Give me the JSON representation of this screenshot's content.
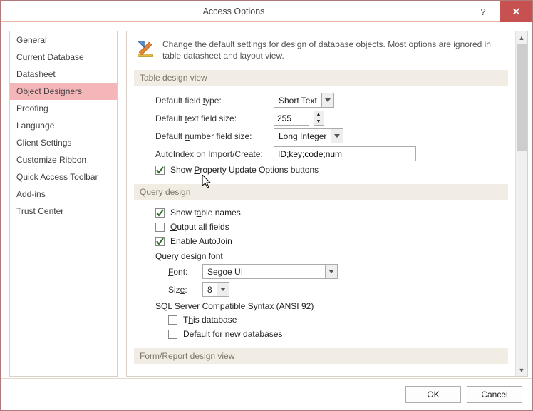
{
  "window": {
    "title": "Access Options"
  },
  "sidebar": {
    "items": [
      {
        "label": "General"
      },
      {
        "label": "Current Database"
      },
      {
        "label": "Datasheet"
      },
      {
        "label": "Object Designers"
      },
      {
        "label": "Proofing"
      },
      {
        "label": "Language"
      },
      {
        "label": "Client Settings"
      },
      {
        "label": "Customize Ribbon"
      },
      {
        "label": "Quick Access Toolbar"
      },
      {
        "label": "Add-ins"
      },
      {
        "label": "Trust Center"
      }
    ],
    "selected_index": 3
  },
  "intro": {
    "text": "Change the default settings for design of database objects. Most options are ignored in table datasheet and layout view."
  },
  "sections": {
    "table_design": {
      "heading": "Table design view",
      "default_field_type": {
        "label": "Default field type:",
        "value": "Short Text"
      },
      "default_text_field_size": {
        "label": "Default text field size:",
        "value": "255"
      },
      "default_number_field_size": {
        "label": "Default number field size:",
        "value": "Long Integer"
      },
      "autoindex": {
        "label": "AutoIndex on Import/Create:",
        "value": "ID;key;code;num"
      },
      "show_property_update": {
        "label": "Show Property Update Options buttons",
        "checked": true
      }
    },
    "query_design": {
      "heading": "Query design",
      "show_table_names": {
        "label": "Show table names",
        "checked": true
      },
      "output_all_fields": {
        "label": "Output all fields",
        "checked": false
      },
      "enable_autojoin": {
        "label": "Enable AutoJoin",
        "checked": true
      },
      "font_heading": "Query design font",
      "font": {
        "label": "Font:",
        "value": "Segoe UI"
      },
      "size": {
        "label": "Size:",
        "value": "8"
      },
      "sql_heading": "SQL Server Compatible Syntax (ANSI 92)",
      "this_database": {
        "label": "This database",
        "checked": false
      },
      "default_new": {
        "label": "Default for new databases",
        "checked": false
      }
    },
    "form_report": {
      "heading": "Form/Report design view"
    }
  },
  "footer": {
    "ok": "OK",
    "cancel": "Cancel"
  }
}
